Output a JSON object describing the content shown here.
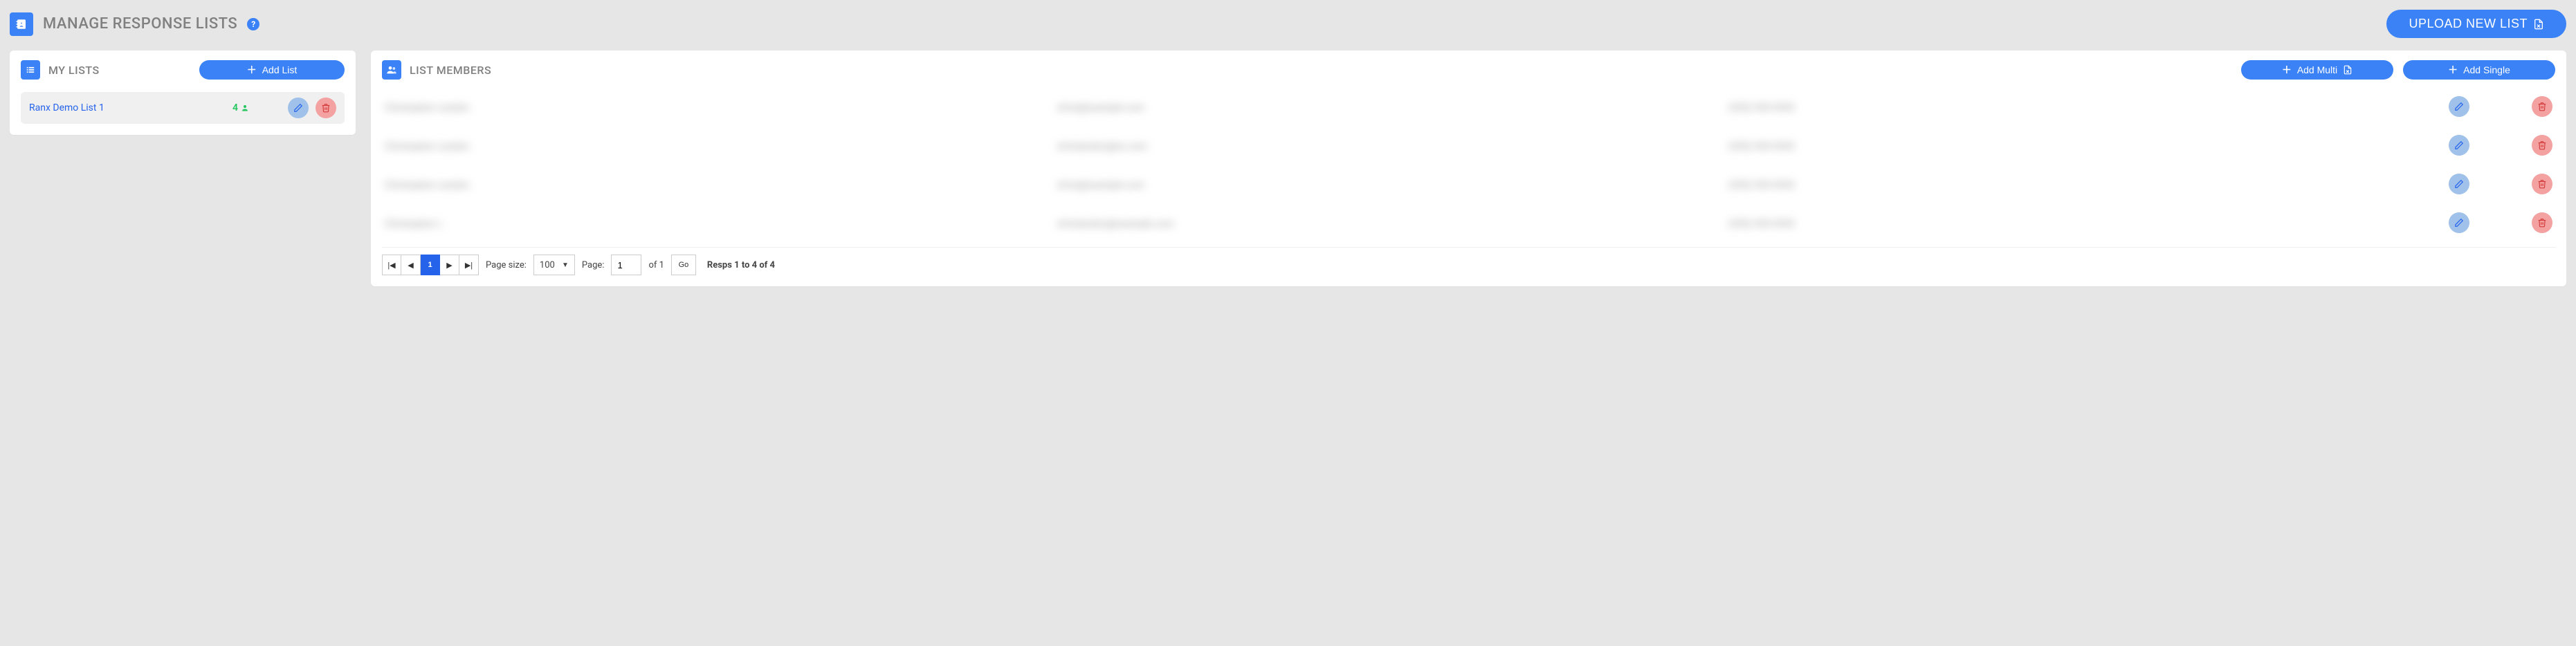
{
  "header": {
    "title": "MANAGE RESPONSE LISTS",
    "upload_label": "UPLOAD NEW LIST"
  },
  "my_lists_panel": {
    "title": "MY LISTS",
    "add_list_label": "Add List",
    "lists": [
      {
        "name": "Ranx Demo List 1",
        "member_count": "4"
      }
    ]
  },
  "members_panel": {
    "title": "LIST MEMBERS",
    "add_multi_label": "Add Multi",
    "add_single_label": "Add Single",
    "members": [
      {
        "name": "Christopher Landon",
        "email": "chris@example.com",
        "phone": "(555) 555-5555"
      },
      {
        "name": "Christopher Landon",
        "email": "chrislandon@ex.com",
        "phone": "(555) 555-5555"
      },
      {
        "name": "Christopher Landon",
        "email": "chris@example.com",
        "phone": "(555) 555-5555"
      },
      {
        "name": "Christopher L",
        "email": "chrislandon@example.com",
        "phone": "(555) 555-5555"
      }
    ]
  },
  "pager": {
    "page_size_label": "Page size:",
    "page_size_value": "100",
    "page_label": "Page:",
    "page_value": "1",
    "of_label": "of 1",
    "go_label": "Go",
    "current_page": "1",
    "summary": "Resps 1 to 4 of 4"
  }
}
